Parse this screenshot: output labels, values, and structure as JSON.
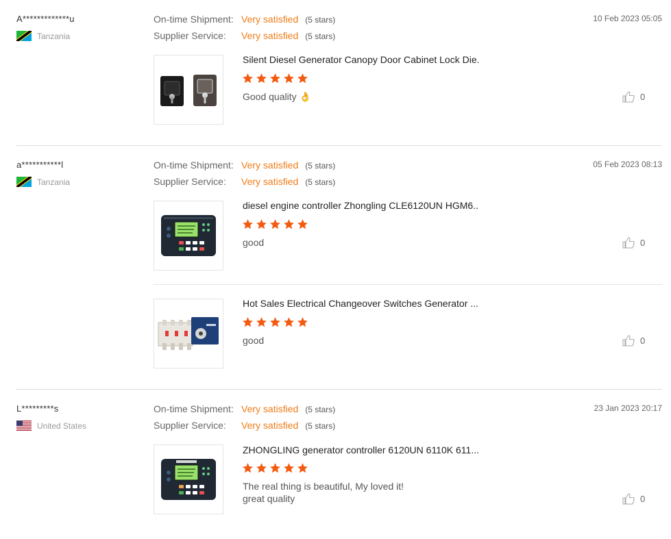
{
  "labels": {
    "on_time_shipment": "On-time Shipment:",
    "supplier_service": "Supplier Service:"
  },
  "colors": {
    "accent": "#f07c18",
    "star": "#f25c12"
  },
  "reviews": [
    {
      "buyer": "A*************u",
      "country": "Tanzania",
      "flag": "tanzania-flag",
      "date": "10 Feb 2023 05:05",
      "on_time": {
        "value": "Very satisfied",
        "stars": "(5 stars)"
      },
      "service": {
        "value": "Very satisfied",
        "stars": "(5 stars)"
      },
      "products": [
        {
          "title": "Silent Diesel Generator Canopy Door Cabinet Lock Die...",
          "rating": 5,
          "comment_lines": [
            "Good quality 👌"
          ],
          "likes": "0",
          "image": "cabinet-lock-image"
        }
      ]
    },
    {
      "buyer": "a***********l",
      "country": "Tanzania",
      "flag": "tanzania-flag",
      "date": "05 Feb 2023 08:13",
      "on_time": {
        "value": "Very satisfied",
        "stars": "(5 stars)"
      },
      "service": {
        "value": "Very satisfied",
        "stars": "(5 stars)"
      },
      "products": [
        {
          "title": "diesel engine controller Zhongling CLE6120UN HGM6...",
          "rating": 5,
          "comment_lines": [
            "good"
          ],
          "likes": "0",
          "image": "controller-image"
        },
        {
          "title": "Hot Sales Electrical Changeover Switches Generator ...",
          "rating": 5,
          "comment_lines": [
            "good"
          ],
          "likes": "0",
          "image": "changeover-switch-image"
        }
      ]
    },
    {
      "buyer": "L*********s",
      "country": "United States",
      "flag": "us-flag",
      "date": "23 Jan 2023 20:17",
      "on_time": {
        "value": "Very satisfied",
        "stars": "(5 stars)"
      },
      "service": {
        "value": "Very satisfied",
        "stars": "(5 stars)"
      },
      "products": [
        {
          "title": "ZHONGLING generator controller 6120UN 6110K 611...",
          "rating": 5,
          "comment_lines": [
            "The real thing is beautiful,  My loved it!",
            "great quality"
          ],
          "likes": "0",
          "image": "controller-image"
        }
      ]
    }
  ]
}
